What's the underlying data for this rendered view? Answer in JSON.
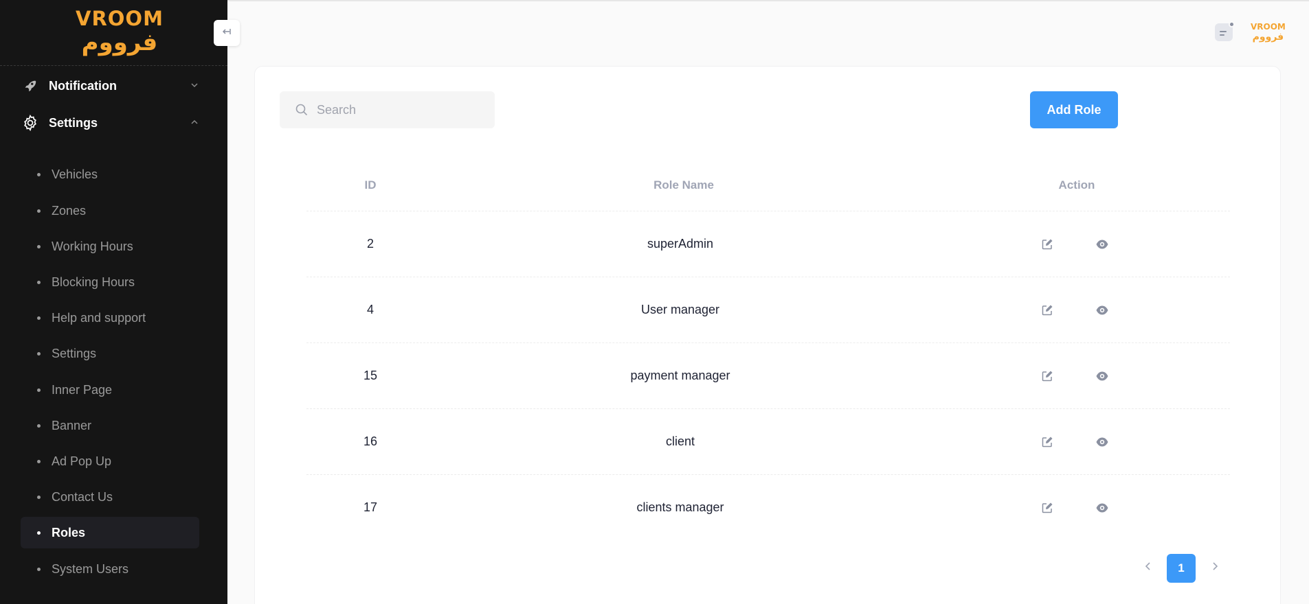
{
  "brand": {
    "logo_en": "VROOM",
    "logo_ar": "فرووم",
    "accent_color": "#f4a532"
  },
  "sidebar": {
    "groups": [
      {
        "label": "Notification",
        "icon": "rocket-icon",
        "expanded": false
      },
      {
        "label": "Settings",
        "icon": "gear-icon",
        "expanded": true
      }
    ],
    "items": [
      {
        "label": "Vehicles"
      },
      {
        "label": "Zones"
      },
      {
        "label": "Working Hours"
      },
      {
        "label": "Blocking Hours"
      },
      {
        "label": "Help and support"
      },
      {
        "label": "Settings"
      },
      {
        "label": "Inner Page"
      },
      {
        "label": "Banner"
      },
      {
        "label": "Ad Pop Up"
      },
      {
        "label": "Contact Us"
      },
      {
        "label": "Roles",
        "active": true
      },
      {
        "label": "System Users"
      }
    ]
  },
  "toolbar": {
    "search_placeholder": "Search",
    "add_label": "Add Role",
    "add_color": "#3c99f8"
  },
  "table": {
    "headers": {
      "id": "ID",
      "role_name": "Role Name",
      "action": "Action"
    },
    "rows": [
      {
        "id": "2",
        "name": "superAdmin"
      },
      {
        "id": "4",
        "name": "User manager"
      },
      {
        "id": "15",
        "name": "payment manager"
      },
      {
        "id": "16",
        "name": "client"
      },
      {
        "id": "17",
        "name": "clients manager"
      }
    ],
    "action_icons": [
      "edit-icon",
      "view-icon"
    ]
  },
  "pagination": {
    "current_page": "1"
  }
}
